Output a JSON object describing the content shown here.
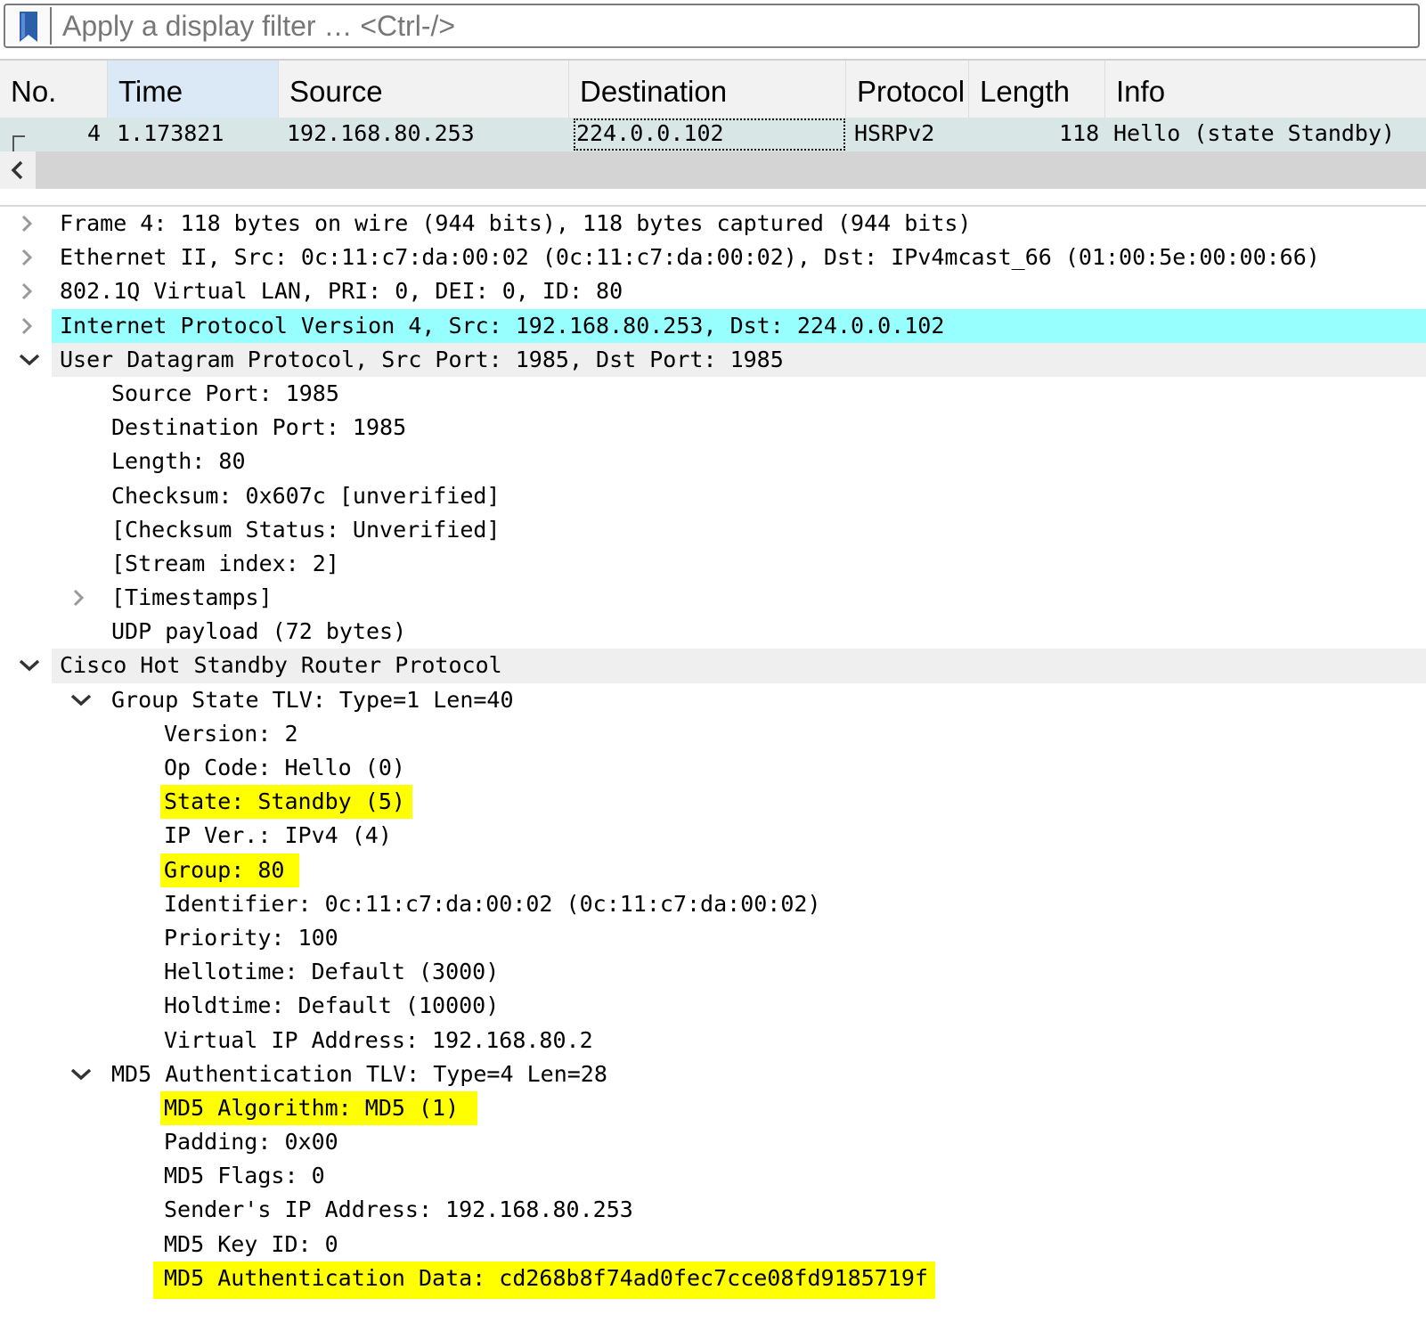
{
  "filter": {
    "placeholder": "Apply a display filter … <Ctrl-/>",
    "bookmark_icon": "bookmark-icon"
  },
  "packet_list": {
    "columns": [
      "No.",
      "Time",
      "Source",
      "Destination",
      "Protocol",
      "Length",
      "Info"
    ],
    "sorted_column": "Time",
    "rows": [
      {
        "no": "4",
        "time": "1.173821",
        "source": "192.168.80.253",
        "destination": "224.0.0.102",
        "protocol": "HSRPv2",
        "length": "118",
        "info": "Hello (state Standby)"
      }
    ]
  },
  "scrollbar": {
    "left_arrow_icon": "chevron-left-icon"
  },
  "details": {
    "frame": "Frame 4: 118 bytes on wire (944 bits), 118 bytes captured (944 bits)",
    "ethernet": "Ethernet II, Src: 0c:11:c7:da:00:02 (0c:11:c7:da:00:02), Dst: IPv4mcast_66 (01:00:5e:00:00:66)",
    "vlan": "802.1Q Virtual LAN, PRI: 0, DEI: 0, ID: 80",
    "ip": "Internet Protocol Version 4, Src: 192.168.80.253, Dst: 224.0.0.102",
    "udp": "User Datagram Protocol, Src Port: 1985, Dst Port: 1985",
    "udp_fields": [
      "Source Port: 1985",
      "Destination Port: 1985",
      "Length: 80",
      "Checksum: 0x607c [unverified]",
      "[Checksum Status: Unverified]",
      "[Stream index: 2]"
    ],
    "timestamps": "[Timestamps]",
    "udp_payload": "UDP payload (72 bytes)",
    "hsrp": "Cisco Hot Standby Router Protocol",
    "group_state_tlv": "Group State TLV: Type=1 Len=40",
    "group_state_fields": [
      "Version: 2",
      "Op Code: Hello (0)",
      "State: Standby (5)",
      "IP Ver.: IPv4 (4)",
      "Group: 80",
      "Identifier: 0c:11:c7:da:00:02 (0c:11:c7:da:00:02)",
      "Priority: 100",
      "Hellotime: Default (3000)",
      "Holdtime: Default (10000)",
      "Virtual IP Address: 192.168.80.2"
    ],
    "md5_tlv": "MD5 Authentication TLV: Type=4 Len=28",
    "md5_fields": [
      "MD5 Algorithm: MD5 (1)",
      "Padding: 0x00",
      "MD5 Flags: 0",
      "Sender's IP Address: 192.168.80.253",
      "MD5 Key ID: 0",
      "MD5 Authentication Data: cd268b8f74ad0fec7cce08fd9185719f"
    ]
  },
  "colors": {
    "selected_row": "#98ffff",
    "packet_row": "#d8e6e6",
    "highlight": "#ffff00",
    "sorted_header": "#dbe9f6"
  }
}
